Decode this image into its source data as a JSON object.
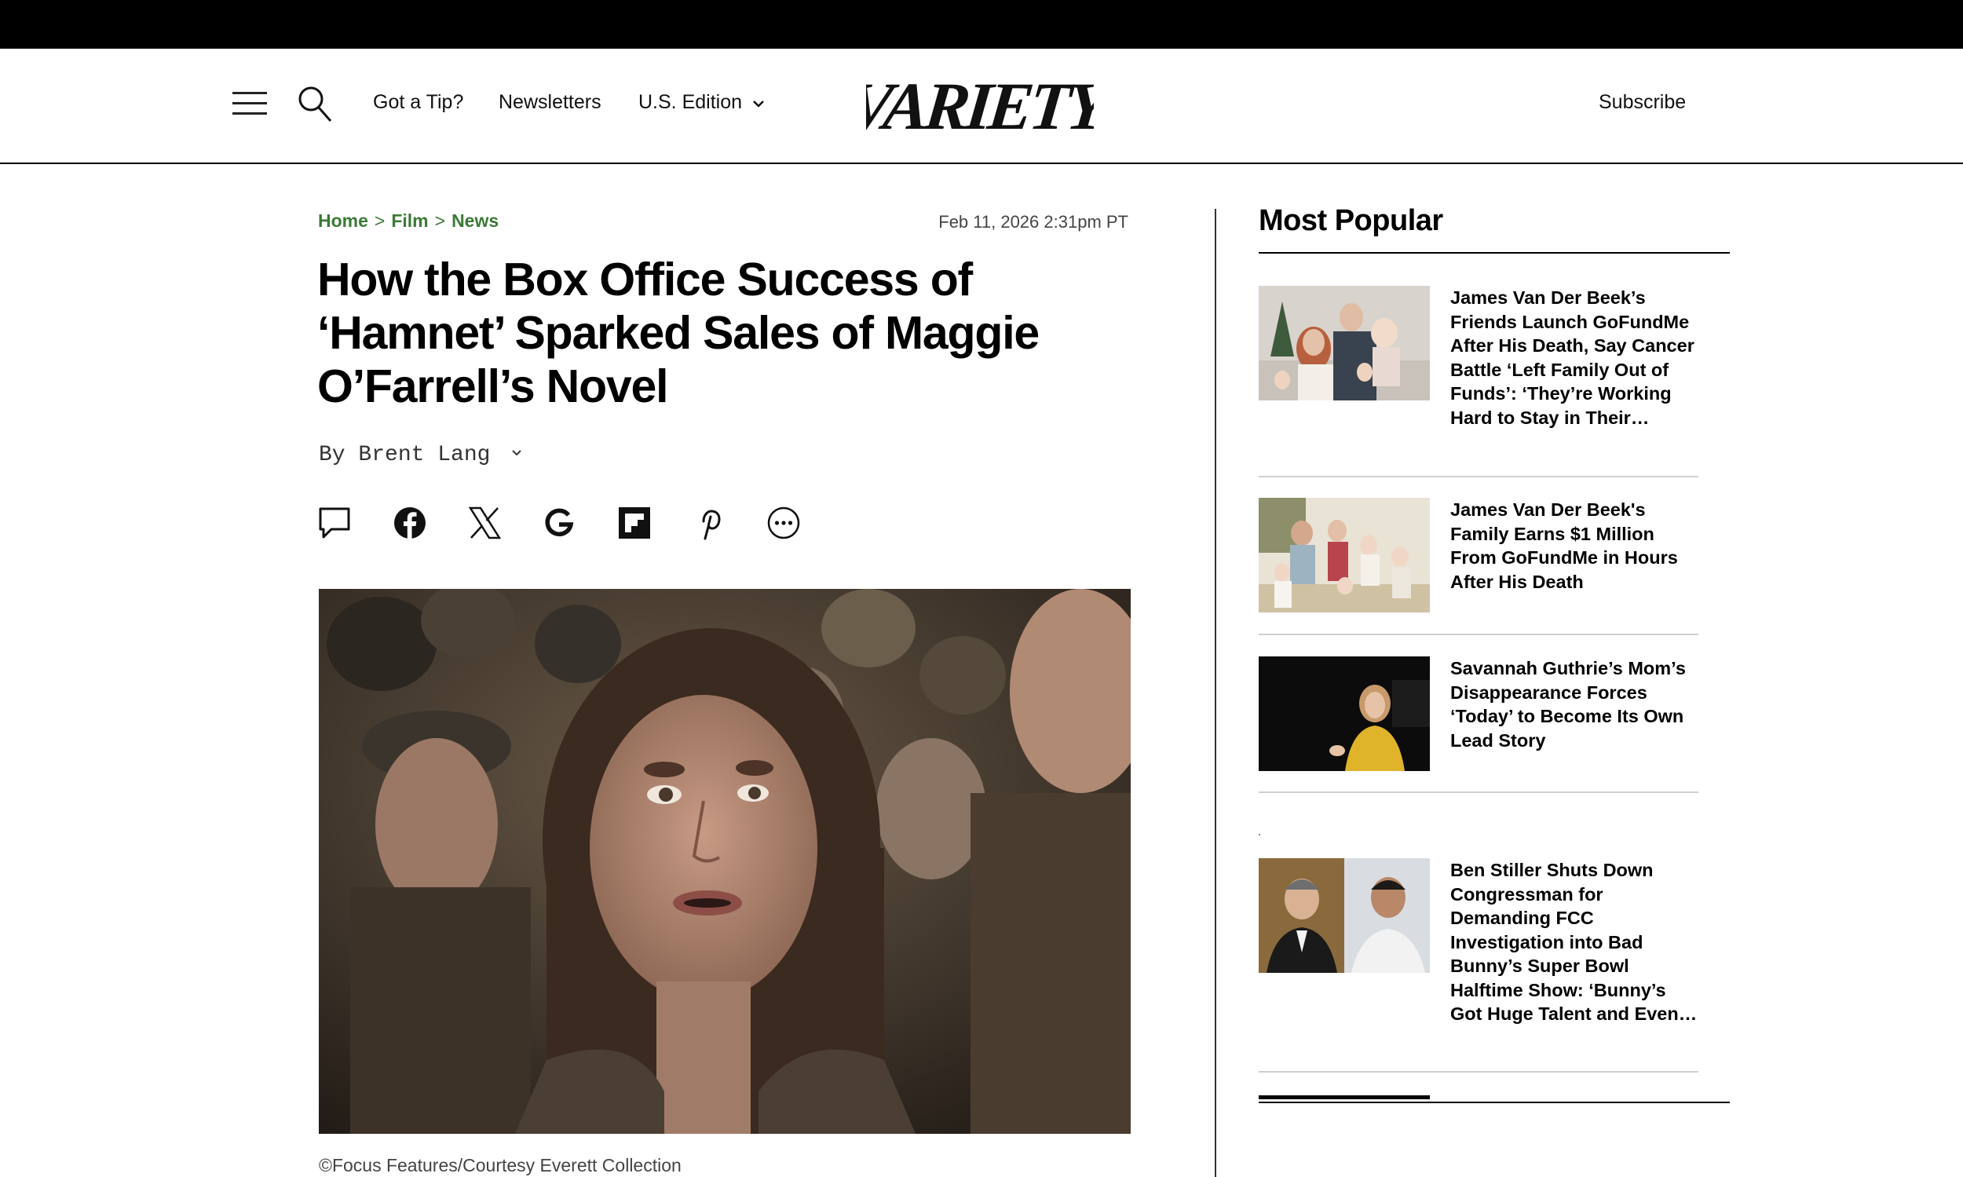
{
  "header": {
    "tip_label": "Got a Tip?",
    "newsletters_label": "Newsletters",
    "edition_label": "U.S. Edition",
    "logo_text": "VARIETY",
    "subscribe_label": "Subscribe"
  },
  "breadcrumb": {
    "items": [
      "Home",
      "Film",
      "News"
    ],
    "separator": ">"
  },
  "article": {
    "timestamp": "Feb 11, 2026 2:31pm PT",
    "headline": "How the Box Office Success of ‘Hamnet’ Sparked Sales of Maggie O’Farrell’s Novel",
    "byline_prefix": "By",
    "author": "Brent Lang",
    "share_icons": [
      "comment-icon",
      "facebook-icon",
      "x-icon",
      "google-icon",
      "flipboard-icon",
      "pinterest-icon",
      "more-icon"
    ],
    "image_caption": "©Focus Features/Courtesy Everett Collection"
  },
  "most_popular": {
    "title": "Most Popular",
    "items": [
      {
        "title": "James Van Der Beek’s Friends Launch GoFundMe After His Death, Say Cancer Battle ‘Left Family Out of Funds’: ‘They’re Working Hard to Stay in Their…"
      },
      {
        "title": "James Van Der Beek's Family Earns $1 Million From GoFundMe in Hours After His Death"
      },
      {
        "title": "Savannah Guthrie’s Mom’s Disappearance Forces ‘Today’ to Become Its Own Lead Story"
      },
      {
        "title": "Ben Stiller Shuts Down Congressman for Demanding FCC Investigation into Bad Bunny’s Super Bowl Halftime Show: ‘Bunny’s Got Huge Talent and Even…"
      }
    ]
  },
  "colors": {
    "breadcrumb_green": "#3b7a36",
    "top_bar": "#000000"
  }
}
